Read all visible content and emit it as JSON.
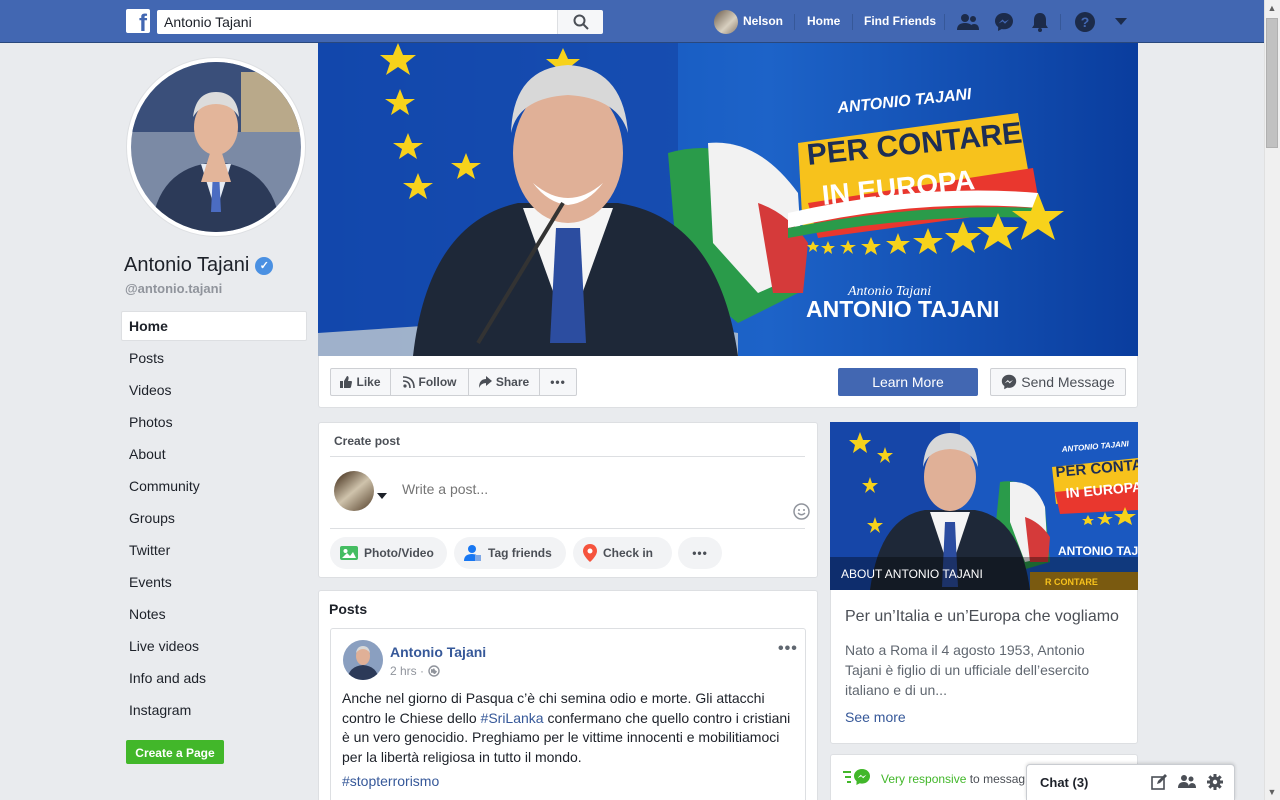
{
  "topbar": {
    "search_value": "Antonio Tajani",
    "user_name": "Nelson",
    "home": "Home",
    "find_friends": "Find Friends"
  },
  "profile": {
    "name": "Antonio Tajani",
    "handle": "@antonio.tajani"
  },
  "sidebar": {
    "items": [
      {
        "label": "Home"
      },
      {
        "label": "Posts"
      },
      {
        "label": "Videos"
      },
      {
        "label": "Photos"
      },
      {
        "label": "About"
      },
      {
        "label": "Community"
      },
      {
        "label": "Groups"
      },
      {
        "label": "Twitter"
      },
      {
        "label": "Events"
      },
      {
        "label": "Notes"
      },
      {
        "label": "Live videos"
      },
      {
        "label": "Info and ads"
      },
      {
        "label": "Instagram"
      }
    ],
    "create_page": "Create a Page"
  },
  "cover": {
    "top_line": "ANTONIO TAJANI",
    "banner_line1": "PER CONTARE",
    "banner_line2": "IN EUROPA",
    "signature": "Antonio Tajani",
    "bottom_name": "ANTONIO TAJANI"
  },
  "actions": {
    "like": "Like",
    "follow": "Follow",
    "share": "Share",
    "more": "•••",
    "learn_more": "Learn More",
    "send_message": "Send Message"
  },
  "create_post": {
    "label": "Create post",
    "placeholder": "Write a post...",
    "photo_video": "Photo/Video",
    "tag_friends": "Tag friends",
    "check_in": "Check in",
    "more": "•••"
  },
  "posts": {
    "title": "Posts",
    "author": "Antonio Tajani",
    "time": "2 hrs ·",
    "menu": "•••",
    "text_part1": "Anche nel giorno di Pasqua c’è chi semina odio e morte. Gli attacchi contro le Chiese dello ",
    "hashtag1": "#SriLanka",
    "text_part2": " confermano che quello contro i cristiani è un vero genocidio. Preghiamo per le vittime innocenti e mobilitiamoci per la libertà religiosa in tutto il mondo.",
    "hashtag2": "#stopterrorismo"
  },
  "about": {
    "img_top": "ANTONIO TAJANI",
    "img_line1": "PER CONTARE",
    "img_line2": "IN EUROPA",
    "img_bottom": "ANTONIO TAJ",
    "img_strip": "R  CONTARE",
    "title": "About Antonio Tajani",
    "headline": "Per un’Italia e un’Europa che vogliamo",
    "description": "Nato a Roma il 4 agosto 1953, Antonio Tajani è figlio di un ufficiale dell’esercito italiano e di un...",
    "see_more": "See more"
  },
  "responsiveness": {
    "label": "Very responsive",
    "rest": " to messag"
  },
  "chat": {
    "label": "Chat (3)"
  },
  "colors": {
    "brand": "#4267b2",
    "link": "#365899",
    "green": "#42b72a",
    "background": "#e9ebee"
  }
}
